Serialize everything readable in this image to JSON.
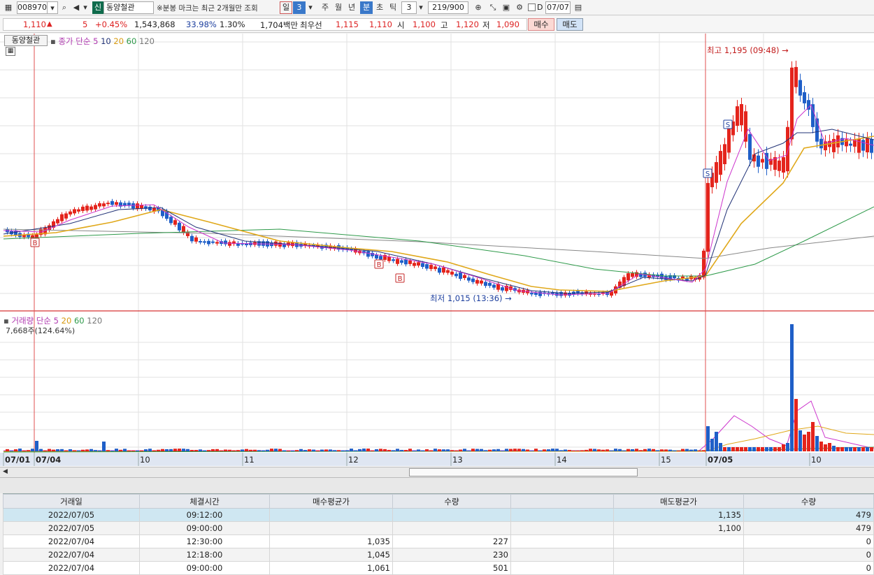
{
  "toolbar": {
    "code": "008970",
    "badge": "신",
    "name": "동양철관",
    "note": "※분봉 마크는 최근 2개월만 조회",
    "periods": [
      "일",
      "3",
      "주",
      "월",
      "년",
      "분",
      "초",
      "틱"
    ],
    "interval": "3",
    "count": "219/900",
    "d_label": "D",
    "date": "07/07"
  },
  "quote": {
    "price": "1,110",
    "change": "5",
    "change_pct": "+0.45%",
    "volume": "1,543,868",
    "vol_ratio": "33.98%",
    "turnover": "1.30%",
    "amount": "1,704백만",
    "best_label": "최우선",
    "best_ask": "1,115",
    "best_bid": "1,110",
    "open_label": "시",
    "open": "1,100",
    "high_label": "고",
    "high": "1,120",
    "low_label": "저",
    "low": "1,090",
    "buy_label": "매수",
    "sell_label": "매도"
  },
  "price_panel": {
    "stock_tag": "동양철관",
    "legend_title": "종가 단순",
    "ma": [
      "5",
      "10",
      "20",
      "60",
      "120"
    ],
    "high_note": "최고 1,195 (09:48)",
    "low_note": "최저 1,015 (13:36)",
    "markers": [
      "B",
      "B",
      "B",
      "S",
      "S"
    ]
  },
  "volume_panel": {
    "legend_title": "거래량 단순",
    "ma": [
      "5",
      "20",
      "60",
      "120"
    ],
    "value_note": "7,668주(124.64%)"
  },
  "time_axis": [
    "07/01",
    "07/04",
    "10",
    "11",
    "12",
    "13",
    "14",
    "15",
    "07/05",
    "10"
  ],
  "colors": {
    "up": "#e4241c",
    "down": "#1f5fc8",
    "ma5": "#cc33cc",
    "ma10": "#223377",
    "ma20": "#e0a81a",
    "ma60": "#2e9a4a",
    "ma120": "#888888"
  },
  "table": {
    "headers": [
      "거래일",
      "체결시간",
      "매수평균가",
      "수량",
      "",
      "매도평균가",
      "수량"
    ],
    "rows": [
      [
        "2022/07/05",
        "09:12:00",
        "",
        "",
        "",
        "1,135",
        "479"
      ],
      [
        "2022/07/05",
        "09:00:00",
        "",
        "",
        "",
        "1,100",
        "479"
      ],
      [
        "2022/07/04",
        "12:30:00",
        "1,035",
        "227",
        "",
        "",
        "0"
      ],
      [
        "2022/07/04",
        "12:18:00",
        "1,045",
        "230",
        "",
        "",
        "0"
      ],
      [
        "2022/07/04",
        "09:00:00",
        "1,061",
        "501",
        "",
        "",
        "0"
      ]
    ]
  }
}
